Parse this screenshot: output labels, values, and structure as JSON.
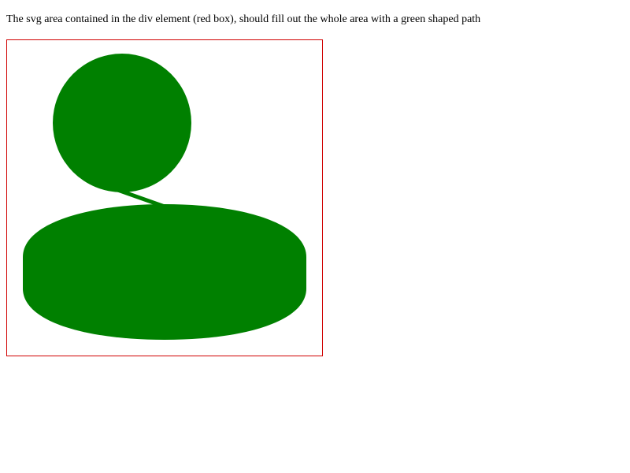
{
  "page": {
    "description_text": "The svg area contained in the div element (red box), should fill out the whole area with a green shaped path"
  },
  "colors": {
    "box_border": "#d00000",
    "shape_fill": "#008000",
    "background": "#ffffff"
  }
}
